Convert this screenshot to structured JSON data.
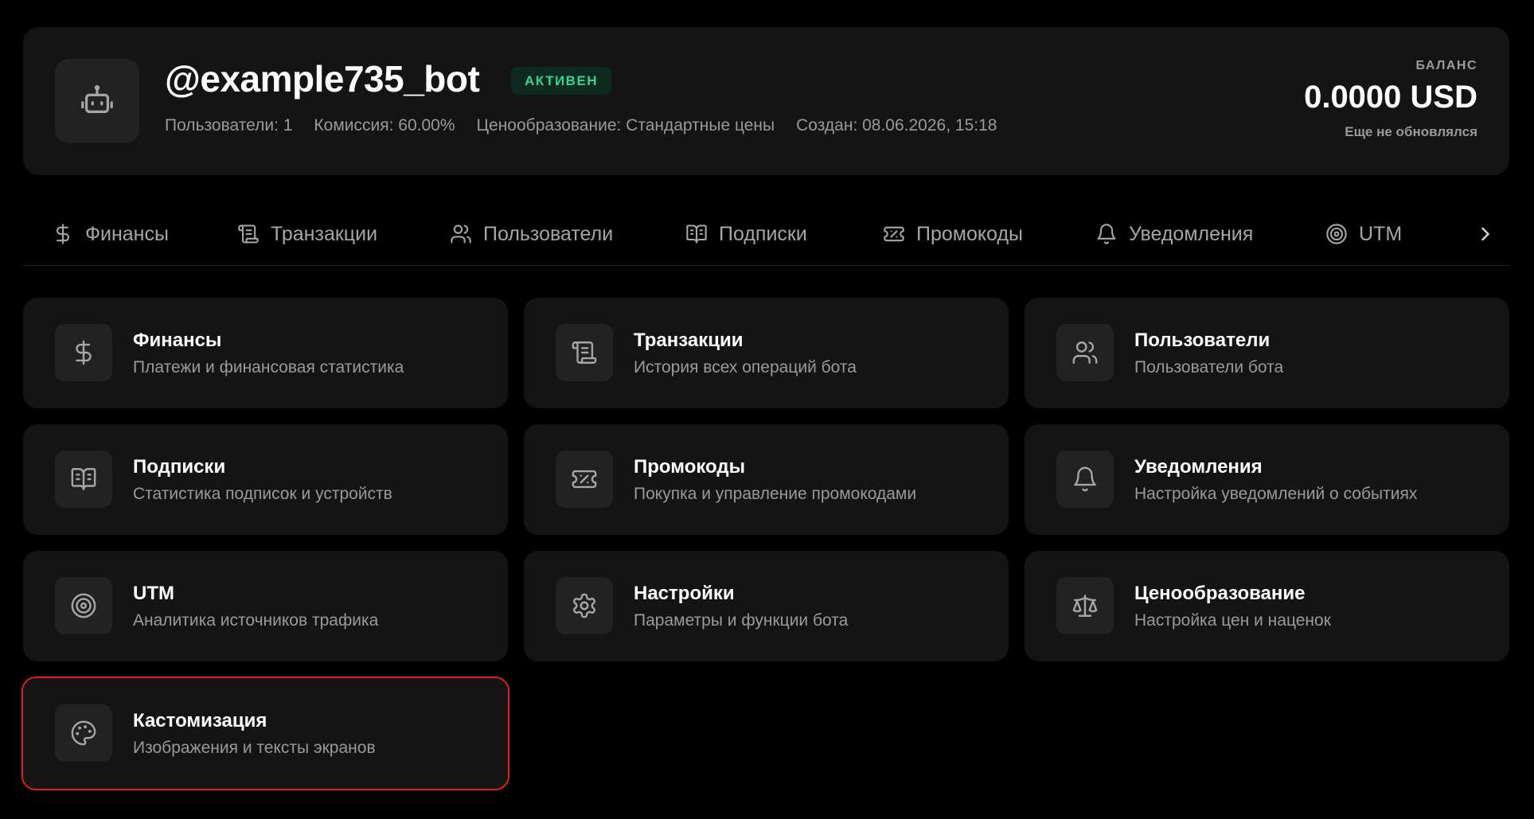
{
  "bot": {
    "name": "@example735_bot",
    "status": "АКТИВЕН",
    "meta": {
      "users": "Пользователи: 1",
      "commission": "Комиссия: 60.00%",
      "pricing": "Ценообразование: Стандартные цены",
      "created": "Создан: 08.06.2026, 15:18"
    }
  },
  "balance": {
    "label": "БАЛАНС",
    "value": "0.0000 USD",
    "updated": "Еще не обновлялся"
  },
  "tabs": [
    {
      "label": "Финансы",
      "icon": "dollar-icon"
    },
    {
      "label": "Транзакции",
      "icon": "scroll-icon"
    },
    {
      "label": "Пользователи",
      "icon": "users-icon"
    },
    {
      "label": "Подписки",
      "icon": "book-open-icon"
    },
    {
      "label": "Промокоды",
      "icon": "ticket-icon"
    },
    {
      "label": "Уведомления",
      "icon": "bell-icon"
    },
    {
      "label": "UTM",
      "icon": "target-icon"
    }
  ],
  "cards": [
    {
      "title": "Финансы",
      "desc": "Платежи и финансовая статистика",
      "icon": "dollar-icon"
    },
    {
      "title": "Транзакции",
      "desc": "История всех операций бота",
      "icon": "scroll-icon"
    },
    {
      "title": "Пользователи",
      "desc": "Пользователи бота",
      "icon": "users-icon"
    },
    {
      "title": "Подписки",
      "desc": "Статистика подписок и устройств",
      "icon": "book-open-icon"
    },
    {
      "title": "Промокоды",
      "desc": "Покупка и управление промокодами",
      "icon": "ticket-icon"
    },
    {
      "title": "Уведомления",
      "desc": "Настройка уведомлений о событиях",
      "icon": "bell-icon"
    },
    {
      "title": "UTM",
      "desc": "Аналитика источников трафика",
      "icon": "target-icon"
    },
    {
      "title": "Настройки",
      "desc": "Параметры и функции бота",
      "icon": "gear-icon"
    },
    {
      "title": "Ценообразование",
      "desc": "Настройка цен и наценок",
      "icon": "scale-icon"
    },
    {
      "title": "Кастомизация",
      "desc": "Изображения и тексты экранов",
      "icon": "palette-icon"
    }
  ],
  "colors": {
    "accent_green": "#34d399",
    "highlight_red": "#e11d1d"
  }
}
